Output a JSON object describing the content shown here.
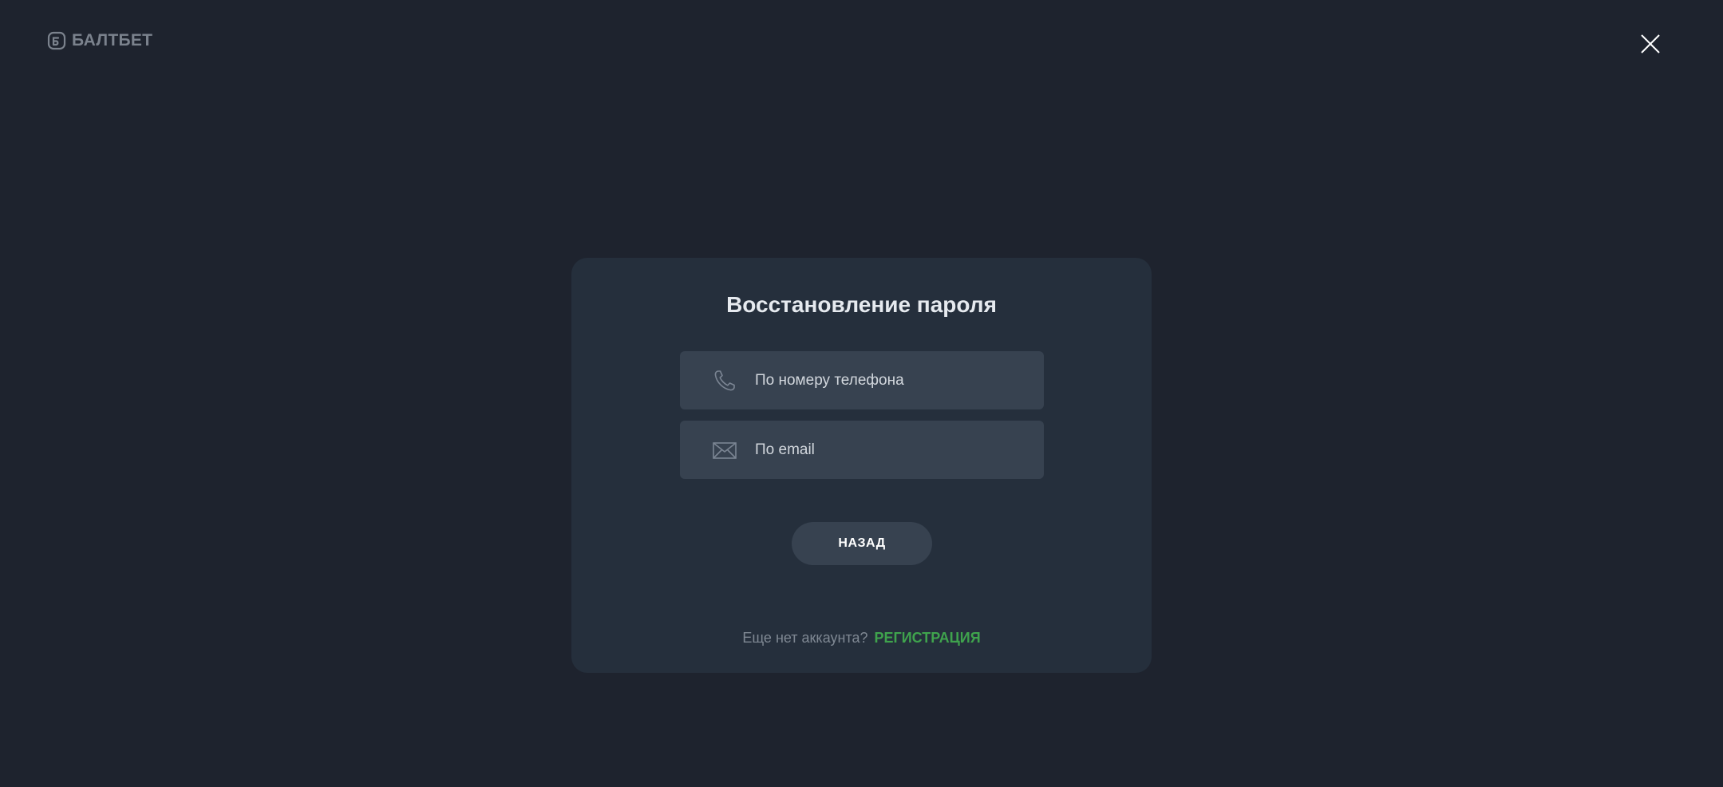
{
  "brand": {
    "name": "БАЛТБЕТ",
    "icon": "baltbet-logo-icon"
  },
  "header": {
    "close_icon": "close-icon"
  },
  "modal": {
    "title": "Восстановление пароля",
    "options": [
      {
        "label": "По номеру телефона",
        "icon": "phone-icon"
      },
      {
        "label": "По email",
        "icon": "envelope-icon"
      }
    ],
    "back_label": "НАЗАД",
    "footer": {
      "text": "Еще нет аккаунта?",
      "link_label": "РЕГИСТРАЦИЯ"
    }
  },
  "colors": {
    "background": "#1e232e",
    "modal": "#252f3c",
    "option": "#374250",
    "accent": "#3fa34d",
    "muted": "#7b828d"
  }
}
